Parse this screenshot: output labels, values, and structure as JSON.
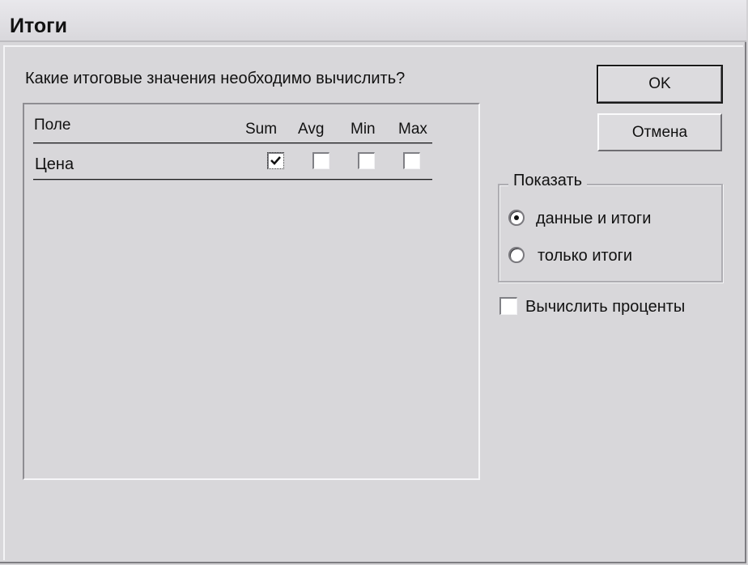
{
  "window": {
    "title": "Итоги"
  },
  "prompt": "Какие итоговые значения необходимо вычислить?",
  "table": {
    "columns": [
      "Поле",
      "Sum",
      "Avg",
      "Min",
      "Max"
    ],
    "rows": [
      {
        "field": "Цена",
        "sum": true,
        "avg": false,
        "min": false,
        "max": false
      }
    ]
  },
  "buttons": {
    "ok": "OK",
    "cancel": "Отмена"
  },
  "show_group": {
    "legend": "Показать",
    "options": [
      {
        "label": "данные и итоги",
        "selected": true
      },
      {
        "label": "только итоги",
        "selected": false
      }
    ]
  },
  "percent_checkbox": {
    "label": "Вычислить проценты",
    "checked": false
  }
}
